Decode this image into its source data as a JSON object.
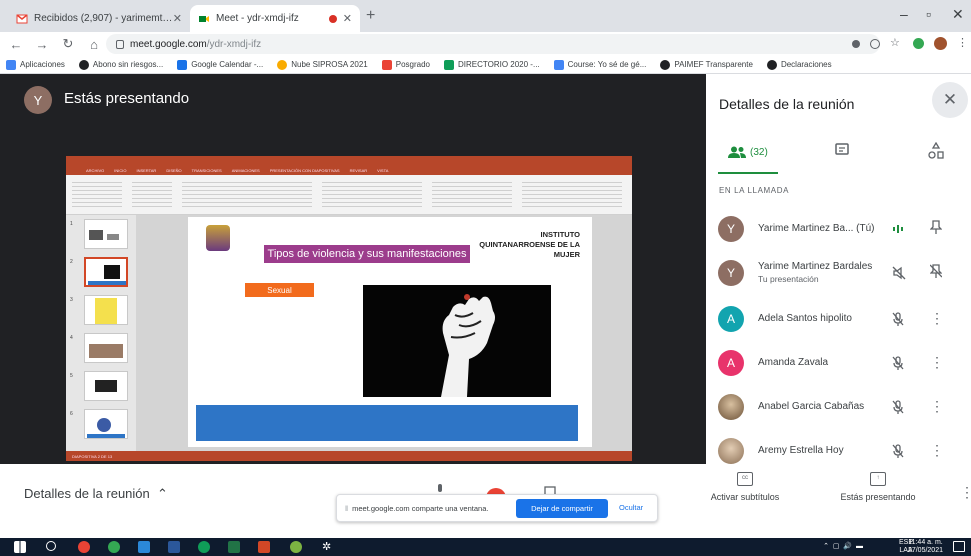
{
  "browser": {
    "tabs": [
      {
        "title": "Recibidos (2,907) - yarimemtz1@...",
        "active": false
      },
      {
        "title": "Meet - ydr-xmdj-ifz",
        "active": true
      }
    ],
    "new_tab": "+",
    "window_controls": {
      "minimize": "–",
      "restore": "▫",
      "close": "✕"
    },
    "url": {
      "host": "meet.google.com",
      "path": "/ydr-xmdj-ifz"
    },
    "bookmarks": [
      {
        "label": "Aplicaciones",
        "color": "#4285f4"
      },
      {
        "label": "Abono sin riesgos...",
        "color": "#202124"
      },
      {
        "label": "Google Calendar -...",
        "color": "#1a73e8"
      },
      {
        "label": "Nube SIPROSA 2021",
        "color": "#f9ab00"
      },
      {
        "label": "Posgrado",
        "color": "#ea4335"
      },
      {
        "label": "DIRECTORIO 2020 -...",
        "color": "#0f9d58"
      },
      {
        "label": "Course: Yo sé de gé...",
        "color": "#4285f4"
      },
      {
        "label": "PAIMEF Transparente",
        "color": "#202124"
      },
      {
        "label": "Declaraciones",
        "color": "#202124"
      }
    ]
  },
  "stage": {
    "presenter_initial": "Y",
    "presenting_label": "Estás presentando"
  },
  "slide": {
    "title": "Tipos de violencia y sus manifestaciones",
    "institute": "INSTITUTO QUINTANARROENSE DE LA MUJER",
    "tag": "Sexual",
    "ribbon_tabs": [
      "ARCHIVO",
      "INICIO",
      "INSERTAR",
      "DISEÑO",
      "TRANSICIONES",
      "ANIMACIONES",
      "PRESENTACIÓN CON DIAPOSITIVAS",
      "REVISAR",
      "VISTA"
    ],
    "status": "DIAPOSITIVA 2 DE 13",
    "thumb_numbers": [
      "1",
      "2",
      "3",
      "4",
      "5",
      "6"
    ]
  },
  "panel": {
    "title": "Detalles de la reunión",
    "close": "✕",
    "people_count": "(32)",
    "in_call_label": "EN LA LLAMADA",
    "participants": [
      {
        "initial": "Y",
        "name": "Yarime Martinez Ba... (Tú)",
        "sub": "",
        "color": "#8d6e63"
      },
      {
        "initial": "Y",
        "name": "Yarime Martinez Bardales",
        "sub": "Tu presentación",
        "color": "#8d6e63"
      },
      {
        "initial": "A",
        "name": "Adela Santos hipolito",
        "sub": "",
        "color": "#12a4af"
      },
      {
        "initial": "A",
        "name": "Amanda Zavala",
        "sub": "",
        "color": "#e8336b"
      },
      {
        "initial": "",
        "name": "Anabel Garcia Cabañas",
        "sub": "",
        "color": "#9b7a5a"
      },
      {
        "initial": "",
        "name": "Aremy Estrella Hoy",
        "sub": "",
        "color": "#b49c84"
      }
    ]
  },
  "bottom": {
    "meeting_details": "Detalles de la reunión",
    "share_notice": "meet.google.com comparte una ventana.",
    "stop_sharing": "Dejar de compartir",
    "hide": "Ocultar",
    "captions": "Activar subtítulos",
    "presenting": "Estás presentando"
  },
  "taskbar": {
    "lang": "ESP",
    "lang2": "LAA",
    "time": "11:44 a. m.",
    "date": "27/05/2021"
  },
  "colors": {
    "meet_green": "#1e8e3e",
    "accent_blue": "#1a73e8",
    "ppt_red": "#b7472a",
    "slide_purple": "#9c3c8c",
    "slide_orange": "#f26b1d",
    "slide_blue": "#2e75c6"
  }
}
